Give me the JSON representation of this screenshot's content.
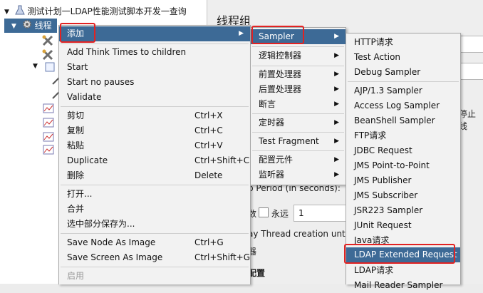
{
  "tree": {
    "root_label": "测试计划一LDAP性能测试脚本开发一查询",
    "thread_group_label": "线程"
  },
  "background": {
    "panel_title": "线程组",
    "stop_fragment": "停止线",
    "ramp_fragment": "p Period (in seconds):",
    "loop_fragment": "数",
    "forever_label": "永远",
    "loop_value": "1",
    "delay_fragment": "ay Thread creation until r",
    "scheduler_fragment": "器",
    "config_fragment": "配置"
  },
  "menu1": {
    "items": [
      {
        "label": "添加",
        "shortcut": ""
      },
      {
        "label": "Add Think Times to children",
        "shortcut": ""
      },
      {
        "label": "Start",
        "shortcut": ""
      },
      {
        "label": "Start no pauses",
        "shortcut": ""
      },
      {
        "label": "Validate",
        "shortcut": ""
      },
      {
        "label": "剪切",
        "shortcut": "Ctrl+X"
      },
      {
        "label": "复制",
        "shortcut": "Ctrl+C"
      },
      {
        "label": "粘贴",
        "shortcut": "Ctrl+V"
      },
      {
        "label": "Duplicate",
        "shortcut": "Ctrl+Shift+C"
      },
      {
        "label": "删除",
        "shortcut": "Delete"
      },
      {
        "label": "打开...",
        "shortcut": ""
      },
      {
        "label": "合并",
        "shortcut": ""
      },
      {
        "label": "选中部分保存为...",
        "shortcut": ""
      },
      {
        "label": "Save Node As Image",
        "shortcut": "Ctrl+G"
      },
      {
        "label": "Save Screen As Image",
        "shortcut": "Ctrl+Shift+G"
      },
      {
        "label": "启用",
        "shortcut": ""
      }
    ]
  },
  "menu2": {
    "items": [
      {
        "label": "Sampler"
      },
      {
        "label": "逻辑控制器"
      },
      {
        "label": "前置处理器"
      },
      {
        "label": "后置处理器"
      },
      {
        "label": "断言"
      },
      {
        "label": "定时器"
      },
      {
        "label": "Test Fragment"
      },
      {
        "label": "配置元件"
      },
      {
        "label": "监听器"
      }
    ]
  },
  "menu3": {
    "items": [
      {
        "label": "HTTP请求"
      },
      {
        "label": "Test Action"
      },
      {
        "label": "Debug Sampler"
      },
      {
        "label": "AJP/1.3 Sampler"
      },
      {
        "label": "Access Log Sampler"
      },
      {
        "label": "BeanShell Sampler"
      },
      {
        "label": "FTP请求"
      },
      {
        "label": "JDBC Request"
      },
      {
        "label": "JMS Point-to-Point"
      },
      {
        "label": "JMS Publisher"
      },
      {
        "label": "JMS Subscriber"
      },
      {
        "label": "JSR223 Sampler"
      },
      {
        "label": "JUnit Request"
      },
      {
        "label": "Java请求"
      },
      {
        "label": "LDAP Extended Request"
      },
      {
        "label": "LDAP请求"
      },
      {
        "label": "Mail Reader Sampler"
      }
    ]
  },
  "colors": {
    "selection": "#3d6a96",
    "highlight_box": "#e22222",
    "menu_bg": "#f2f2f2"
  }
}
